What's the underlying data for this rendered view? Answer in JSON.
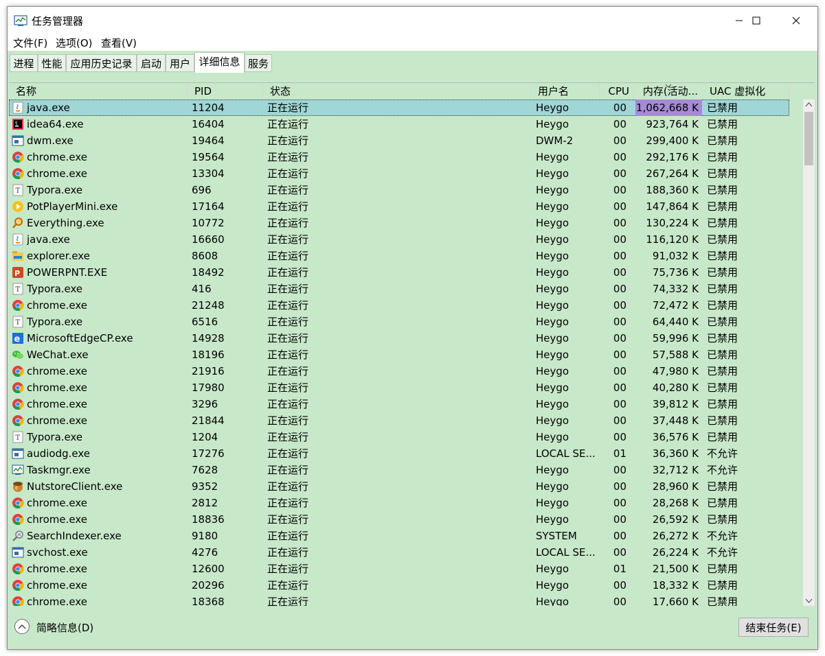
{
  "window": {
    "title": "任务管理器"
  },
  "menu": [
    "文件(F)",
    "选项(O)",
    "查看(V)"
  ],
  "tabs": [
    "进程",
    "性能",
    "应用历史记录",
    "启动",
    "用户",
    "详细信息",
    "服务"
  ],
  "active_tab": "详细信息",
  "columns": [
    "名称",
    "PID",
    "状态",
    "用户名",
    "CPU",
    "内存(活动...",
    "UAC 虚拟化"
  ],
  "rows": [
    {
      "name": "java.exe",
      "pid": "11204",
      "status": "正在运行",
      "user": "Heygo",
      "cpu": "00",
      "mem": "1,062,668 K",
      "uac": "已禁用",
      "icon": "java-icon"
    },
    {
      "name": "idea64.exe",
      "pid": "16404",
      "status": "正在运行",
      "user": "Heygo",
      "cpu": "00",
      "mem": "923,764 K",
      "uac": "已禁用",
      "icon": "intellij-idea-icon"
    },
    {
      "name": "dwm.exe",
      "pid": "19464",
      "status": "正在运行",
      "user": "DWM-2",
      "cpu": "00",
      "mem": "299,400 K",
      "uac": "已禁用",
      "icon": "system-window-icon"
    },
    {
      "name": "chrome.exe",
      "pid": "19564",
      "status": "正在运行",
      "user": "Heygo",
      "cpu": "00",
      "mem": "292,176 K",
      "uac": "已禁用",
      "icon": "chrome-icon"
    },
    {
      "name": "chrome.exe",
      "pid": "13304",
      "status": "正在运行",
      "user": "Heygo",
      "cpu": "00",
      "mem": "267,264 K",
      "uac": "已禁用",
      "icon": "chrome-icon"
    },
    {
      "name": "Typora.exe",
      "pid": "696",
      "status": "正在运行",
      "user": "Heygo",
      "cpu": "00",
      "mem": "188,360 K",
      "uac": "已禁用",
      "icon": "typora-icon"
    },
    {
      "name": "PotPlayerMini.exe",
      "pid": "17164",
      "status": "正在运行",
      "user": "Heygo",
      "cpu": "00",
      "mem": "147,864 K",
      "uac": "已禁用",
      "icon": "potplayer-icon"
    },
    {
      "name": "Everything.exe",
      "pid": "10772",
      "status": "正在运行",
      "user": "Heygo",
      "cpu": "00",
      "mem": "130,224 K",
      "uac": "已禁用",
      "icon": "everything-search-icon"
    },
    {
      "name": "java.exe",
      "pid": "16660",
      "status": "正在运行",
      "user": "Heygo",
      "cpu": "00",
      "mem": "116,120 K",
      "uac": "已禁用",
      "icon": "java-icon"
    },
    {
      "name": "explorer.exe",
      "pid": "8608",
      "status": "正在运行",
      "user": "Heygo",
      "cpu": "00",
      "mem": "91,032 K",
      "uac": "已禁用",
      "icon": "explorer-folder-icon"
    },
    {
      "name": "POWERPNT.EXE",
      "pid": "18492",
      "status": "正在运行",
      "user": "Heygo",
      "cpu": "00",
      "mem": "75,736 K",
      "uac": "已禁用",
      "icon": "powerpoint-icon"
    },
    {
      "name": "Typora.exe",
      "pid": "416",
      "status": "正在运行",
      "user": "Heygo",
      "cpu": "00",
      "mem": "74,332 K",
      "uac": "已禁用",
      "icon": "typora-icon"
    },
    {
      "name": "chrome.exe",
      "pid": "21248",
      "status": "正在运行",
      "user": "Heygo",
      "cpu": "00",
      "mem": "72,472 K",
      "uac": "已禁用",
      "icon": "chrome-icon"
    },
    {
      "name": "Typora.exe",
      "pid": "6516",
      "status": "正在运行",
      "user": "Heygo",
      "cpu": "00",
      "mem": "64,440 K",
      "uac": "已禁用",
      "icon": "typora-icon"
    },
    {
      "name": "MicrosoftEdgeCP.exe",
      "pid": "14928",
      "status": "正在运行",
      "user": "Heygo",
      "cpu": "00",
      "mem": "59,996 K",
      "uac": "已禁用",
      "icon": "edge-icon"
    },
    {
      "name": "WeChat.exe",
      "pid": "18196",
      "status": "正在运行",
      "user": "Heygo",
      "cpu": "00",
      "mem": "57,588 K",
      "uac": "已禁用",
      "icon": "wechat-icon"
    },
    {
      "name": "chrome.exe",
      "pid": "21916",
      "status": "正在运行",
      "user": "Heygo",
      "cpu": "00",
      "mem": "47,980 K",
      "uac": "已禁用",
      "icon": "chrome-icon"
    },
    {
      "name": "chrome.exe",
      "pid": "17980",
      "status": "正在运行",
      "user": "Heygo",
      "cpu": "00",
      "mem": "40,280 K",
      "uac": "已禁用",
      "icon": "chrome-icon"
    },
    {
      "name": "chrome.exe",
      "pid": "3296",
      "status": "正在运行",
      "user": "Heygo",
      "cpu": "00",
      "mem": "39,812 K",
      "uac": "已禁用",
      "icon": "chrome-icon"
    },
    {
      "name": "chrome.exe",
      "pid": "21844",
      "status": "正在运行",
      "user": "Heygo",
      "cpu": "00",
      "mem": "37,448 K",
      "uac": "已禁用",
      "icon": "chrome-icon"
    },
    {
      "name": "Typora.exe",
      "pid": "1204",
      "status": "正在运行",
      "user": "Heygo",
      "cpu": "00",
      "mem": "36,576 K",
      "uac": "已禁用",
      "icon": "typora-icon"
    },
    {
      "name": "audiodg.exe",
      "pid": "17276",
      "status": "正在运行",
      "user": "LOCAL SE...",
      "cpu": "01",
      "mem": "36,360 K",
      "uac": "不允许",
      "icon": "system-window-icon"
    },
    {
      "name": "Taskmgr.exe",
      "pid": "7628",
      "status": "正在运行",
      "user": "Heygo",
      "cpu": "00",
      "mem": "32,712 K",
      "uac": "不允许",
      "icon": "task-manager-icon"
    },
    {
      "name": "NutstoreClient.exe",
      "pid": "9352",
      "status": "正在运行",
      "user": "Heygo",
      "cpu": "00",
      "mem": "28,960 K",
      "uac": "已禁用",
      "icon": "nutstore-icon"
    },
    {
      "name": "chrome.exe",
      "pid": "2812",
      "status": "正在运行",
      "user": "Heygo",
      "cpu": "00",
      "mem": "28,268 K",
      "uac": "已禁用",
      "icon": "chrome-icon"
    },
    {
      "name": "chrome.exe",
      "pid": "18836",
      "status": "正在运行",
      "user": "Heygo",
      "cpu": "00",
      "mem": "26,592 K",
      "uac": "已禁用",
      "icon": "chrome-icon"
    },
    {
      "name": "SearchIndexer.exe",
      "pid": "9180",
      "status": "正在运行",
      "user": "SYSTEM",
      "cpu": "00",
      "mem": "26,272 K",
      "uac": "不允许",
      "icon": "search-indexer-icon"
    },
    {
      "name": "svchost.exe",
      "pid": "4276",
      "status": "正在运行",
      "user": "LOCAL SE...",
      "cpu": "00",
      "mem": "26,224 K",
      "uac": "不允许",
      "icon": "system-window-icon"
    },
    {
      "name": "chrome.exe",
      "pid": "12600",
      "status": "正在运行",
      "user": "Heygo",
      "cpu": "01",
      "mem": "21,500 K",
      "uac": "已禁用",
      "icon": "chrome-icon"
    },
    {
      "name": "chrome.exe",
      "pid": "20296",
      "status": "正在运行",
      "user": "Heygo",
      "cpu": "00",
      "mem": "18,332 K",
      "uac": "已禁用",
      "icon": "chrome-icon"
    },
    {
      "name": "chrome.exe",
      "pid": "18368",
      "status": "正在运行",
      "user": "Heygo",
      "cpu": "00",
      "mem": "17,660 K",
      "uac": "已禁用",
      "icon": "chrome-icon"
    }
  ],
  "selected_row": 0,
  "footer": {
    "fewer_details": "简略信息(D)",
    "end_task": "结束任务(E)"
  },
  "colors": {
    "background": "#c8e8ca",
    "selected_row": "#a0d6d6",
    "memory_highlight": "#a58ad6"
  }
}
